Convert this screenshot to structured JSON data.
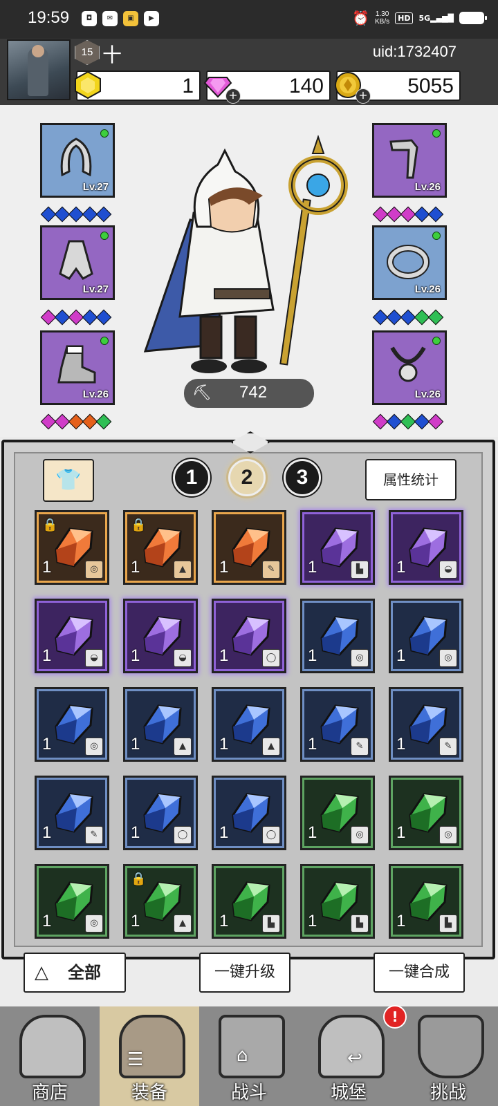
{
  "status_bar": {
    "time": "19:59",
    "speed_top": "1.30",
    "speed_bottom": "KB/s",
    "hd": "HD",
    "network": "5G"
  },
  "player": {
    "level": "15",
    "name": "十",
    "uid": "uid:1732407"
  },
  "resources": [
    {
      "name": "gold-bar",
      "value": "1"
    },
    {
      "name": "diamond",
      "value": "140"
    },
    {
      "name": "coin",
      "value": "5055"
    }
  ],
  "equipment": {
    "left": [
      {
        "item": "hood",
        "level": "Lv.27",
        "gems": [
          "blue",
          "blue",
          "blue",
          "blue",
          "blue"
        ]
      },
      {
        "item": "cloak",
        "level": "Lv.27",
        "gems": [
          "pink",
          "blue",
          "pink",
          "blue",
          "blue"
        ]
      },
      {
        "item": "boots",
        "level": "Lv.26",
        "gems": [
          "pink",
          "pink",
          "orange",
          "orange",
          "green"
        ]
      }
    ],
    "right": [
      {
        "item": "staff",
        "level": "Lv.26",
        "gems": [
          "pink",
          "pink",
          "pink",
          "blue",
          "blue"
        ]
      },
      {
        "item": "ring",
        "level": "Lv.26",
        "gems": [
          "blue",
          "blue",
          "blue",
          "green",
          "green"
        ]
      },
      {
        "item": "necklace",
        "level": "Lv.26",
        "gems": [
          "pink",
          "blue",
          "green",
          "blue",
          "pink"
        ]
      }
    ]
  },
  "power": "742",
  "tabs": {
    "pages": [
      "1",
      "2",
      "3"
    ],
    "active_page": "2",
    "stats_button": "属性统计"
  },
  "inventory": [
    {
      "rarity": "orange",
      "qty": "1",
      "type": "ring",
      "locked": true
    },
    {
      "rarity": "orange",
      "qty": "1",
      "type": "cloak",
      "locked": true
    },
    {
      "rarity": "orange",
      "qty": "1",
      "type": "staff",
      "locked": false
    },
    {
      "rarity": "purple",
      "qty": "1",
      "type": "boots",
      "locked": false
    },
    {
      "rarity": "purple",
      "qty": "1",
      "type": "hood",
      "locked": false
    },
    {
      "rarity": "purple",
      "qty": "1",
      "type": "hood",
      "locked": false
    },
    {
      "rarity": "purple",
      "qty": "1",
      "type": "hood",
      "locked": false
    },
    {
      "rarity": "purple",
      "qty": "1",
      "type": "necklace",
      "locked": false
    },
    {
      "rarity": "blue",
      "qty": "1",
      "type": "ring",
      "locked": false
    },
    {
      "rarity": "blue",
      "qty": "1",
      "type": "ring",
      "locked": false
    },
    {
      "rarity": "blue",
      "qty": "1",
      "type": "ring",
      "locked": false
    },
    {
      "rarity": "blue",
      "qty": "1",
      "type": "cloak",
      "locked": false
    },
    {
      "rarity": "blue",
      "qty": "1",
      "type": "cloak",
      "locked": false
    },
    {
      "rarity": "blue",
      "qty": "1",
      "type": "staff",
      "locked": false
    },
    {
      "rarity": "blue",
      "qty": "1",
      "type": "staff",
      "locked": false
    },
    {
      "rarity": "blue",
      "qty": "1",
      "type": "staff",
      "locked": false
    },
    {
      "rarity": "blue",
      "qty": "1",
      "type": "necklace",
      "locked": false
    },
    {
      "rarity": "blue",
      "qty": "1",
      "type": "necklace",
      "locked": false
    },
    {
      "rarity": "green",
      "qty": "1",
      "type": "ring",
      "locked": false
    },
    {
      "rarity": "green",
      "qty": "1",
      "type": "ring",
      "locked": false
    },
    {
      "rarity": "green",
      "qty": "1",
      "type": "ring",
      "locked": false
    },
    {
      "rarity": "green",
      "qty": "1",
      "type": "cloak",
      "locked": true
    },
    {
      "rarity": "green",
      "qty": "1",
      "type": "boots",
      "locked": false
    },
    {
      "rarity": "green",
      "qty": "1",
      "type": "boots",
      "locked": false
    },
    {
      "rarity": "green",
      "qty": "1",
      "type": "boots",
      "locked": false
    }
  ],
  "actions": {
    "all": "全部",
    "upgrade": "一键升级",
    "merge": "一键合成"
  },
  "nav": [
    {
      "label": "商店",
      "active": false
    },
    {
      "label": "装备",
      "active": true
    },
    {
      "label": "战斗",
      "active": false
    },
    {
      "label": "城堡",
      "active": false
    },
    {
      "label": "挑战",
      "active": false
    }
  ],
  "nav_badge": "!",
  "colors": {
    "gem_blue": "#1f4fd1",
    "gem_pink": "#d03cc8",
    "gem_green": "#2fbf55",
    "gem_orange": "#e5601a",
    "rarity_orange": "#e9a64c",
    "rarity_purple": "#8f62d8",
    "rarity_blue": "#6f8fc4",
    "rarity_green": "#5ea462"
  }
}
